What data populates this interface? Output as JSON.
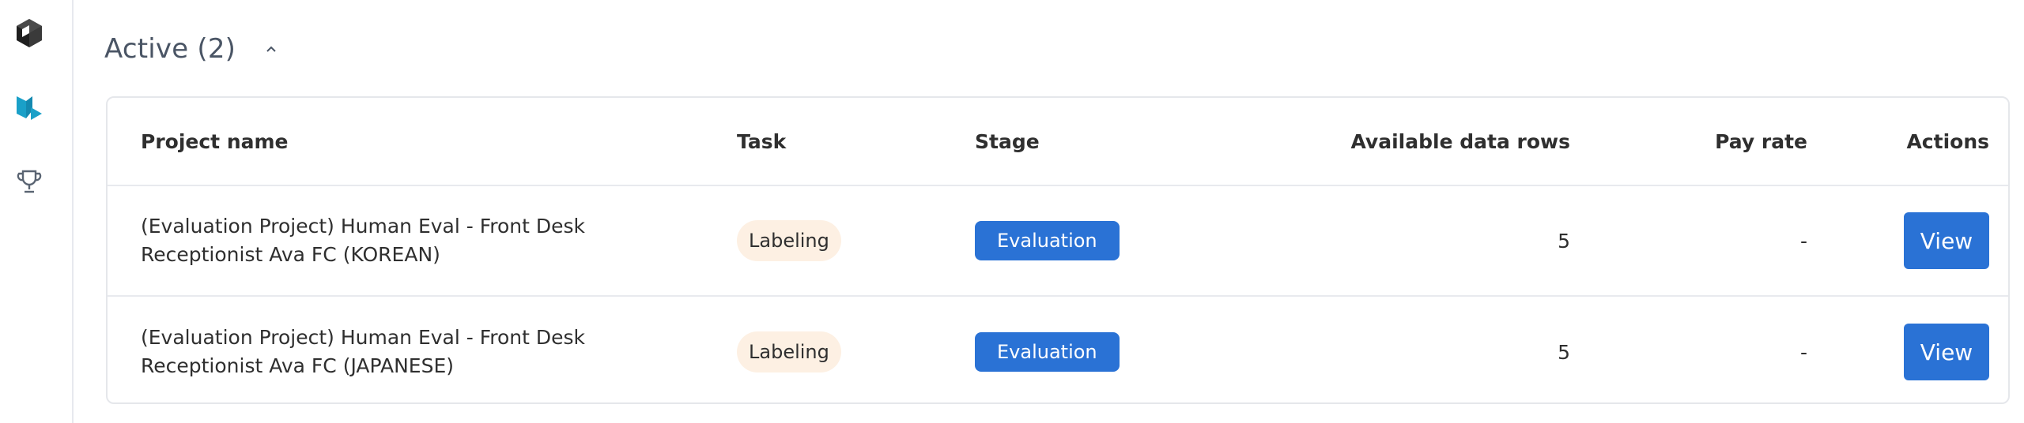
{
  "sidebar": {
    "items": [
      {
        "icon": "cube-logo-icon"
      },
      {
        "icon": "workforce-icon",
        "color": "#1aa0c8"
      },
      {
        "icon": "trophy-icon"
      }
    ]
  },
  "section": {
    "title": "Active (2)",
    "toggle_icon": "chevron-up-icon"
  },
  "table": {
    "columns": {
      "project_name": "Project name",
      "task": "Task",
      "stage": "Stage",
      "available_rows": "Available data rows",
      "pay_rate": "Pay rate",
      "actions": "Actions"
    },
    "rows": [
      {
        "project_name": "(Evaluation Project) Human Eval - Front Desk Receptionist Ava FC (KOREAN)",
        "task": "Labeling",
        "stage": "Evaluation",
        "available_rows": "5",
        "pay_rate": "-",
        "action": "View"
      },
      {
        "project_name": "(Evaluation Project) Human Eval - Front Desk Receptionist Ava FC (JAPANESE)",
        "task": "Labeling",
        "stage": "Evaluation",
        "available_rows": "5",
        "pay_rate": "-",
        "action": "View"
      }
    ]
  },
  "colors": {
    "accent": "#2a72d5",
    "task_pill_bg": "#fdf0e3",
    "workforce_icon": "#1aa0c8"
  }
}
